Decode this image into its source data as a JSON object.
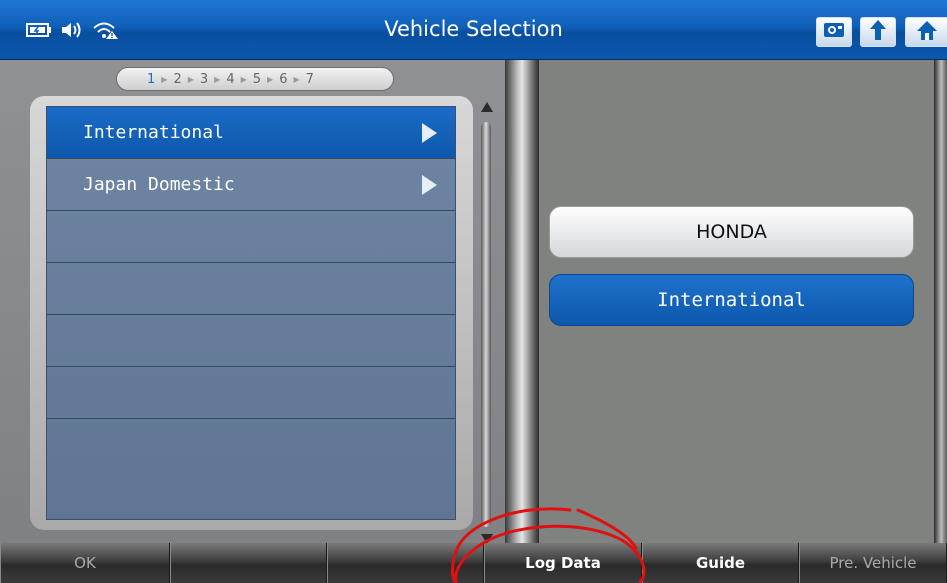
{
  "header": {
    "title": "Vehicle Selection",
    "status_icons": [
      "battery-icon",
      "speaker-icon",
      "wifi-warning-icon"
    ],
    "tools": [
      "screenshot-icon",
      "back-icon",
      "home-icon"
    ]
  },
  "steps": {
    "items": [
      "1",
      "2",
      "3",
      "4",
      "5",
      "6",
      "7"
    ],
    "current": "1"
  },
  "vehicle_list": {
    "items": [
      {
        "label": "International",
        "selected": true
      },
      {
        "label": "Japan Domestic",
        "selected": false
      },
      {
        "label": "",
        "selected": false
      },
      {
        "label": "",
        "selected": false
      },
      {
        "label": "",
        "selected": false
      },
      {
        "label": "",
        "selected": false
      },
      {
        "label": "",
        "selected": false
      }
    ]
  },
  "selection_path": {
    "make": "HONDA",
    "region": "International"
  },
  "bottom_bar": {
    "buttons": [
      {
        "label": "OK",
        "enabled": false
      },
      {
        "label": "",
        "enabled": false
      },
      {
        "label": "",
        "enabled": false
      },
      {
        "label": "Log Data",
        "enabled": true
      },
      {
        "label": "Guide",
        "enabled": true
      },
      {
        "label": "Pre. Vehicle",
        "enabled": false
      }
    ]
  },
  "colors": {
    "accent": "#0c58ad",
    "annotation": "#e01010"
  }
}
